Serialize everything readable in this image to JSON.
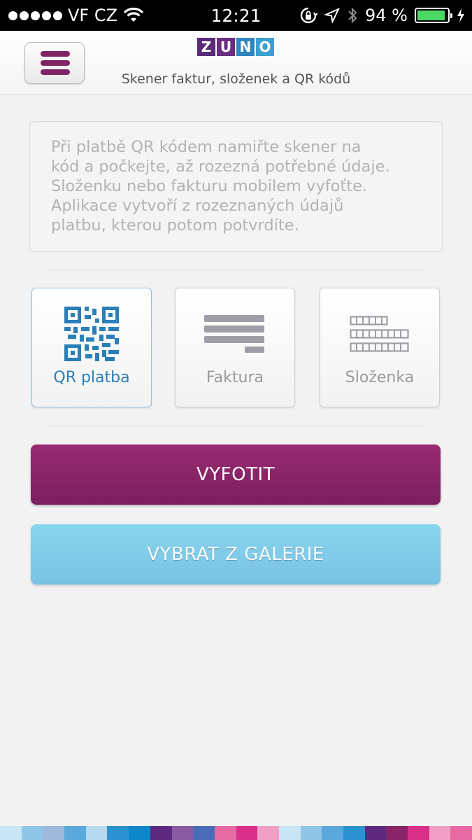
{
  "status_bar": {
    "carrier": "VF CZ",
    "time": "12:21",
    "battery_percent_text": "94 %",
    "battery_level": 0.94,
    "signal_dots": 5,
    "icons": [
      "signal-dots-icon",
      "wifi-icon",
      "rotation-lock-icon",
      "location-icon",
      "bluetooth-icon",
      "battery-icon",
      "charging-icon"
    ]
  },
  "header": {
    "logo_letters": [
      "Z",
      "U",
      "N",
      "O"
    ],
    "logo_colors": [
      "#5b2a7a",
      "#6a2d80",
      "#2e86c1",
      "#3ca0d0"
    ],
    "subtitle": "Skener faktur, složenek a QR kódů",
    "menu_color": "#7e2463"
  },
  "info": {
    "lines": [
      "Při platbě QR kódem namiřte skener na",
      "kód a počkejte, až rozezná potřebné údaje.",
      "Složenku nebo fakturu mobilem vyfoťte.",
      "Aplikace vytvoří z rozeznaných údajů",
      "platbu, kterou potom potvrdíte."
    ]
  },
  "options": [
    {
      "label": "QR platba",
      "icon": "qr-code-icon",
      "selected": true
    },
    {
      "label": "Faktura",
      "icon": "invoice-icon",
      "selected": false
    },
    {
      "label": "Složenka",
      "icon": "payment-slip-icon",
      "selected": false
    }
  ],
  "buttons": {
    "photo": "VYFOTIT",
    "gallery": "VYBRAT Z GALERIE"
  },
  "colors": {
    "accent_purple": "#8a2468",
    "accent_blue": "#7fcbe8",
    "qr_blue": "#2b7fb8",
    "icon_gray": "#9d9ea6"
  },
  "strip_colors": [
    "#c9e4f4",
    "#8fc6e8",
    "#9fb9dc",
    "#5aa8dc",
    "#b7d9ef",
    "#2d92d2",
    "#0d86c9",
    "#5e2a80",
    "#8a5aa3",
    "#4a6db8",
    "#e76aa3",
    "#d9308a",
    "#f0a0c4",
    "#c9e4f4",
    "#8fc6e8",
    "#5aa8dc",
    "#2d92d2",
    "#5e2a80",
    "#8a2468",
    "#d9308a",
    "#f0a0c4",
    "#e76aa3"
  ]
}
